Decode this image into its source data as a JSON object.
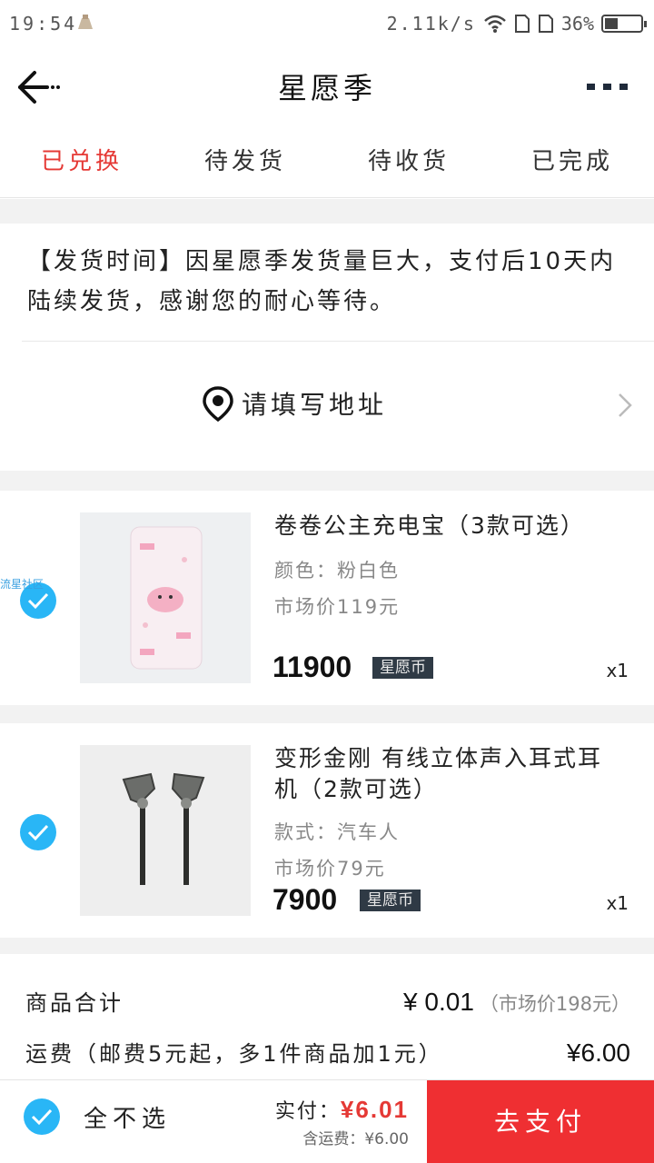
{
  "status_bar": {
    "time": "19:54",
    "network_speed": "2.11k/s",
    "battery": "36%",
    "battery_level": 0.36
  },
  "nav": {
    "title": "星愿季",
    "back_icon": "back-arrow-icon",
    "more_icon": "more-dots-icon"
  },
  "tabs": [
    {
      "label": "已兑换",
      "active": true
    },
    {
      "label": "待发货",
      "active": false
    },
    {
      "label": "待收货",
      "active": false
    },
    {
      "label": "已完成",
      "active": false
    }
  ],
  "notice": {
    "text": "【发货时间】因星愿季发货量巨大，支付后10天内陆续发货，感谢您的耐心等待。"
  },
  "address": {
    "label": "请填写地址",
    "icon": "location-pin-icon"
  },
  "watermark": "流星社区",
  "products": [
    {
      "title": "卷卷公主充电宝（3款可选）",
      "attr": "颜色：粉白色",
      "market_price": "市场价119元",
      "price": "11900",
      "currency": "星愿币",
      "qty": "x1",
      "checked": true
    },
    {
      "title": "变形金刚 有线立体声入耳式耳机（2款可选）",
      "attr": "款式：汽车人",
      "market_price": "市场价79元",
      "price": "7900",
      "currency": "星愿币",
      "qty": "x1",
      "checked": true
    }
  ],
  "summary": {
    "goods_label": "商品合计",
    "goods_value": "¥ 0.01",
    "goods_note": "（市场价198元）",
    "shipping_label": "运费（邮费5元起，多1件商品加1元）",
    "shipping_value": "¥6.00"
  },
  "footer": {
    "select_all_label": "全不选",
    "pay_label": "实付：",
    "pay_amount": "¥6.01",
    "shipping_note": "含运费：¥6.00",
    "pay_button": "去支付"
  },
  "colors": {
    "accent_red": "#e53935",
    "pay_button": "#ef2f32",
    "check_blue": "#29b6f6",
    "badge_dark": "#2f3a45"
  }
}
